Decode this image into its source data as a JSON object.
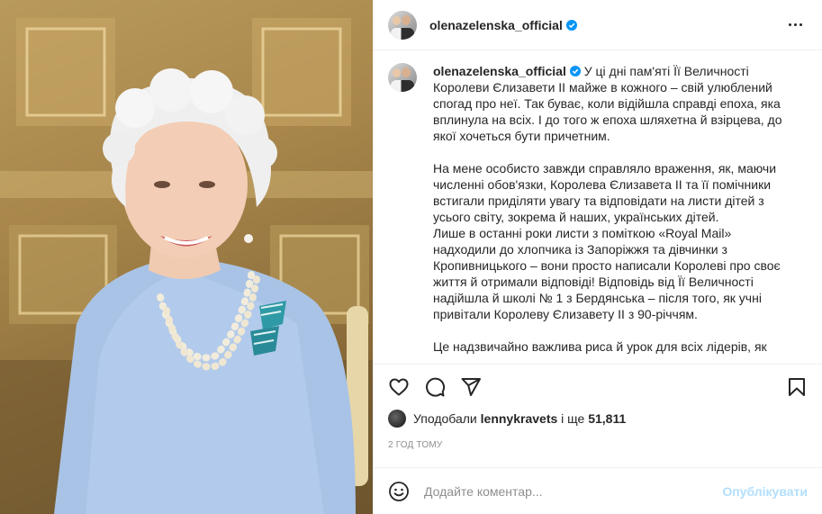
{
  "post": {
    "author": "olenazelenska_official",
    "caption_paragraphs": [
      "У ці дні пам'яті Її Величності Королеви Єлизавети ІІ майже в кожного – свій улюблений спогад про неї. Так буває, коли відійшла справді епоха, яка вплинула на всіх. І до того ж епоха шляхетна й взірцева, до якої хочеться бути причетним.",
      "На мене особисто завжди справляло враження, як, маючи численні обов'язки, Королева Єлизавета ІІ та її помічники встигали приділяти увагу та відповідати на листи дітей з усього світу, зокрема й наших, українських дітей.\nЛише в останні роки листи з поміткою «Royal Mail» надходили до хлопчика із Запоріжжя та дівчинки з Кропивницького – вони просто написали Королеві про своє життя й отримали відповіді! Відповідь від Її Величності надійшла й школі № 1 з Бердянська – після того, як учні привітали Королеву Єлизавету ІІ з 90-річчям.",
      "Це надзвичайно важлива риса й урок для всіх лідерів, як"
    ],
    "likes": {
      "prefix": "Уподобали",
      "user": "lennykravets",
      "connector": "і ще",
      "count": "51,811"
    },
    "timestamp": "2 ГОД ТОМУ"
  },
  "comment": {
    "placeholder": "Додайте коментар...",
    "publish_label": "Опублікувати"
  },
  "icons": {
    "verified": "verified-badge-icon",
    "more": "more-options-icon",
    "like": "heart-icon",
    "comment": "comment-icon",
    "share": "share-icon",
    "save": "bookmark-icon",
    "emoji": "emoji-icon"
  },
  "colors": {
    "verified": "#0095f6",
    "publish_disabled": "#b2dffc",
    "text": "#262626",
    "muted": "#8e8e8e"
  }
}
